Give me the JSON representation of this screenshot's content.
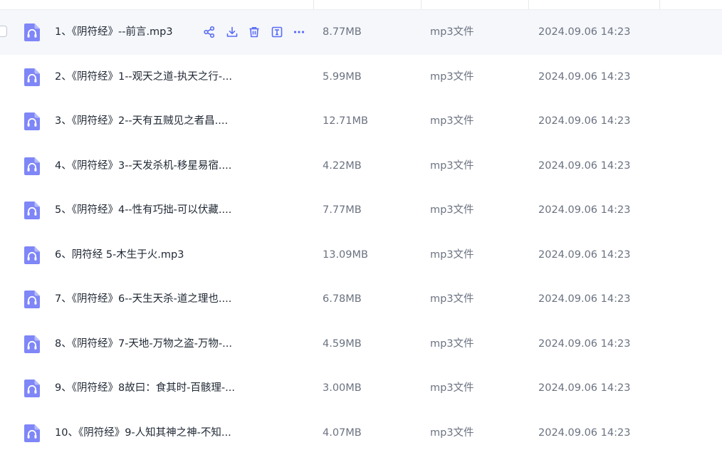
{
  "accent_color": "#5b6cf5",
  "icon_color": "#7f86f7",
  "row_actions": [
    {
      "name": "share-icon"
    },
    {
      "name": "download-icon"
    },
    {
      "name": "delete-icon"
    },
    {
      "name": "rename-icon"
    },
    {
      "name": "more-icon"
    }
  ],
  "files": [
    {
      "name": "1、《阴符经》--前言.mp3",
      "size": "8.77MB",
      "type": "mp3文件",
      "modified": "2024.09.06 14:23",
      "hovered": true
    },
    {
      "name": "2、《阴符经》1--观天之道-执天之行-...",
      "size": "5.99MB",
      "type": "mp3文件",
      "modified": "2024.09.06 14:23"
    },
    {
      "name": "3、《阴符经》2--天有五贼见之者昌....",
      "size": "12.71MB",
      "type": "mp3文件",
      "modified": "2024.09.06 14:23"
    },
    {
      "name": "4、《阴符经》3--天发杀机-移星易宿....",
      "size": "4.22MB",
      "type": "mp3文件",
      "modified": "2024.09.06 14:23"
    },
    {
      "name": "5、《阴符经》4--性有巧拙-可以伏藏....",
      "size": "7.77MB",
      "type": "mp3文件",
      "modified": "2024.09.06 14:23"
    },
    {
      "name": "6、阴符经 5-木生于火.mp3",
      "size": "13.09MB",
      "type": "mp3文件",
      "modified": "2024.09.06 14:23"
    },
    {
      "name": "7、《阴符经》6--天生天杀-道之理也....",
      "size": "6.78MB",
      "type": "mp3文件",
      "modified": "2024.09.06 14:23"
    },
    {
      "name": "8、《阴符经》7-天地-万物之盗-万物-...",
      "size": "4.59MB",
      "type": "mp3文件",
      "modified": "2024.09.06 14:23"
    },
    {
      "name": "9、《阴符经》8故曰：食其时-百骸理-...",
      "size": "3.00MB",
      "type": "mp3文件",
      "modified": "2024.09.06 14:23"
    },
    {
      "name": "10、《阴符经》9-人知其神之神-不知...",
      "size": "4.07MB",
      "type": "mp3文件",
      "modified": "2024.09.06 14:23"
    }
  ]
}
